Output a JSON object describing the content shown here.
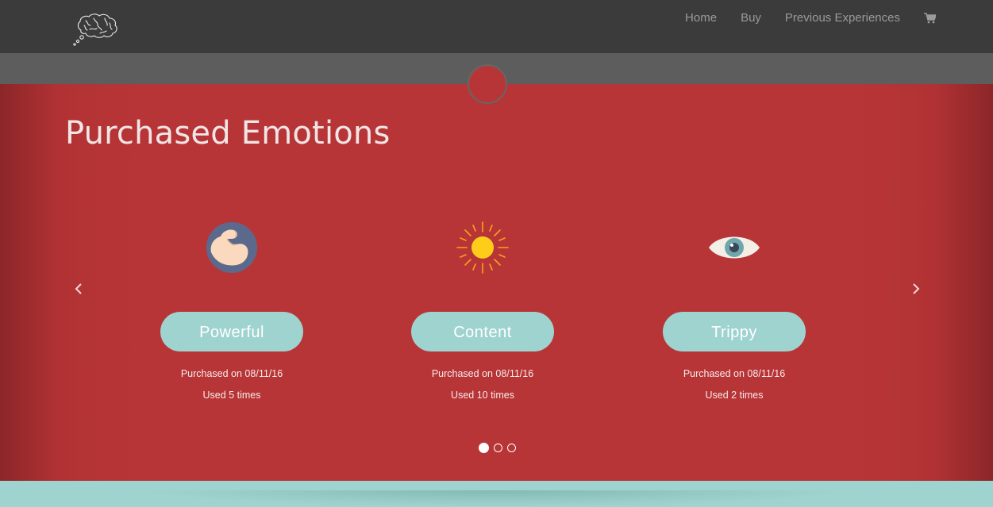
{
  "nav": {
    "links": [
      "Home",
      "Buy",
      "Previous Experiences"
    ],
    "logo_icon": "brain-thought-icon",
    "cart_icon": "shopping-cart-icon"
  },
  "hero": {
    "title": "Purchased Emotions",
    "prev_icon": "chevron-left-icon",
    "next_icon": "chevron-right-icon",
    "cards": [
      {
        "label": "Powerful",
        "icon": "flexed-arm-icon",
        "purchased": "Purchased on 08/11/16",
        "used": "Used 5 times"
      },
      {
        "label": "Content",
        "icon": "sun-icon",
        "purchased": "Purchased on 08/11/16",
        "used": "Used 10 times"
      },
      {
        "label": "Trippy",
        "icon": "eye-icon",
        "purchased": "Purchased on 08/11/16",
        "used": "Used 2 times"
      }
    ],
    "pagination": {
      "pages": 3,
      "active": 1
    }
  },
  "colors": {
    "navbar": "#3b3b3b",
    "strip": "#5d5d5d",
    "hero": "#b83537",
    "accent": "#9fd3cf",
    "nav_text": "#9a9a9a"
  }
}
